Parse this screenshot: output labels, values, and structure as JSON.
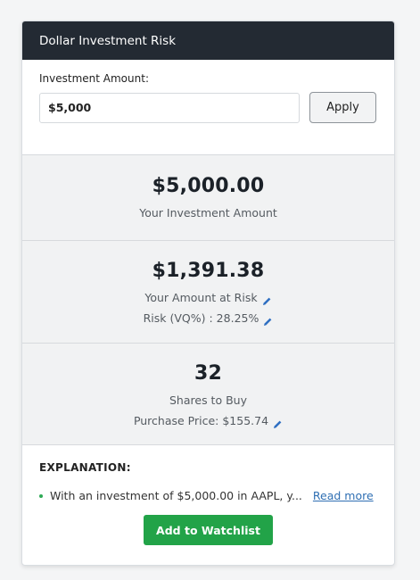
{
  "card": {
    "title": "Dollar Investment Risk"
  },
  "input": {
    "label": "Investment Amount:",
    "value": "$5,000",
    "apply_label": "Apply"
  },
  "investment": {
    "value": "$5,000.00",
    "label": "Your Investment Amount"
  },
  "risk": {
    "value": "$1,391.38",
    "label": "Your Amount at Risk",
    "vq_text": "Risk (VQ%) : 28.25%"
  },
  "shares": {
    "value": "32",
    "label": "Shares to Buy",
    "price_text": "Purchase Price: $155.74"
  },
  "explanation": {
    "title": "EXPLANATION:",
    "text": "With an investment of $5,000.00 in AAPL, y...",
    "read_more": "Read more"
  },
  "watchlist": {
    "button_label": "Add to Watchlist"
  },
  "colors": {
    "header_bg": "#232a33",
    "accent_green": "#22a348",
    "link_blue": "#2f6fb3",
    "edit_icon_blue": "#2f6fc2"
  },
  "icons": {
    "edit": "pencil-icon",
    "bullet": "bullet-icon"
  }
}
